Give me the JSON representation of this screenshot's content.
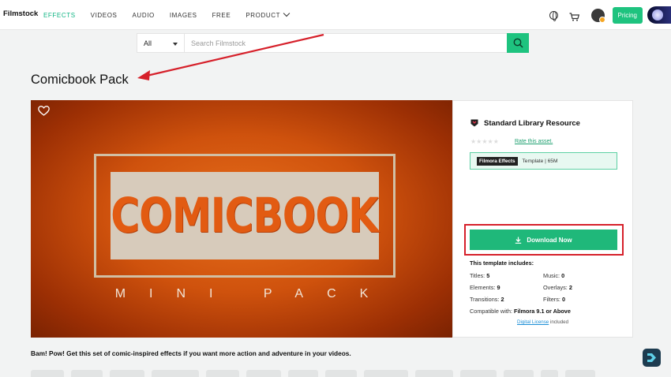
{
  "nav": {
    "logo": "Filmstock",
    "links": [
      "EFFECTS",
      "VIDEOS",
      "AUDIO",
      "IMAGES",
      "FREE",
      "PRODUCT"
    ],
    "active": "EFFECTS",
    "pricing_label": "Pricing"
  },
  "search": {
    "category": "All",
    "placeholder": "Search Filmstock"
  },
  "page": {
    "title": "Comicbook Pack"
  },
  "hero": {
    "main_text": "COMICBOOK",
    "sub_text": "MINI PACK"
  },
  "panel": {
    "resource_title": "Standard Library Resource",
    "rating_stars": "★★★★★",
    "rate_label": "Rate this asset.",
    "product_badge": "Filmora Effects",
    "product_meta": "Template | 65M",
    "download_label": "Download Now",
    "includes_title": "This template includes:",
    "includes": [
      {
        "label": "Titles:",
        "value": "5"
      },
      {
        "label": "Music:",
        "value": "0"
      },
      {
        "label": "Elements:",
        "value": "9"
      },
      {
        "label": "Overlays:",
        "value": "2"
      },
      {
        "label": "Transitions:",
        "value": "2"
      },
      {
        "label": "Filters:",
        "value": "0"
      }
    ],
    "compat_label": "Compatible with:",
    "compat_value": "Filmora 9.1 or Above",
    "license_link": "Digital License",
    "license_suffix": "included"
  },
  "description": "Bam! Pow! Get this set of comic-inspired effects if you want more action and adventure in your videos.",
  "colors": {
    "accent": "#1ec37f",
    "annotation": "#d6202a",
    "hero_orange": "#cf520d"
  }
}
